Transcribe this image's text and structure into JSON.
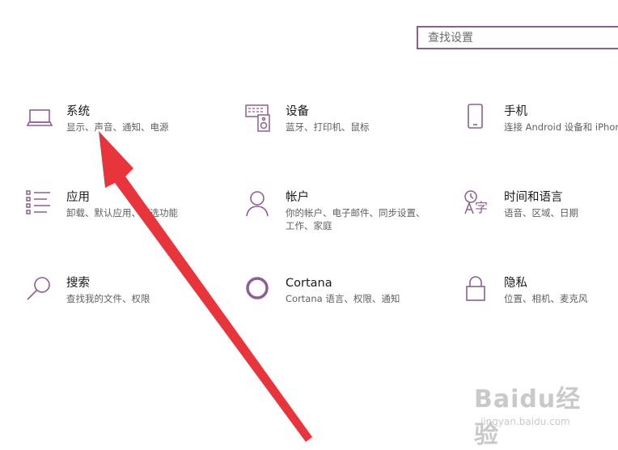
{
  "search": {
    "placeholder": "查找设置"
  },
  "tiles": [
    {
      "title": "系统",
      "desc": "显示、声音、通知、电源"
    },
    {
      "title": "设备",
      "desc": "蓝牙、打印机、鼠标"
    },
    {
      "title": "手机",
      "desc": "连接 Android 设备和 iPhone"
    },
    {
      "title": "应用",
      "desc": "卸载、默认应用、可选功能"
    },
    {
      "title": "帐户",
      "desc": "你的帐户、电子邮件、同步设置、工作、家庭"
    },
    {
      "title": "时间和语言",
      "desc": "语音、区域、日期"
    },
    {
      "title": "搜索",
      "desc": "查找我的文件、权限"
    },
    {
      "title": "Cortana",
      "desc": "Cortana 语言、权限、通知"
    },
    {
      "title": "隐私",
      "desc": "位置、相机、麦克风"
    }
  ],
  "watermark": {
    "brand": "Baidu经验",
    "url": "jingyan.baidu.com"
  },
  "colors": {
    "accent": "#8e5d93",
    "arrow": "#e8353b"
  }
}
